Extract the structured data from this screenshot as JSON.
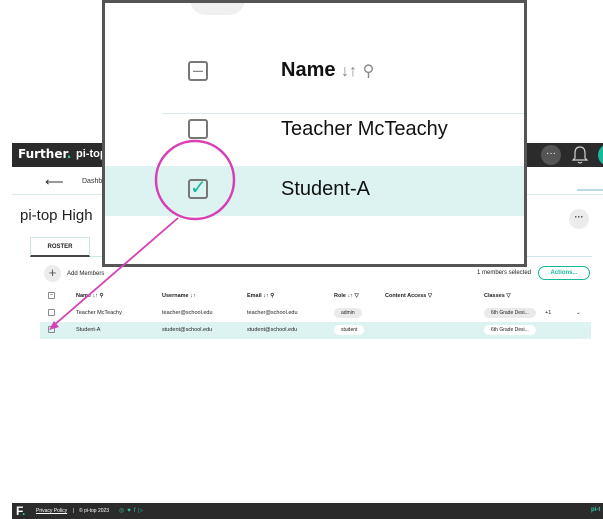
{
  "topbar": {
    "brand": "Further",
    "brand_dot": ".",
    "app_name": "pi-top",
    "avatar_initials": "Th",
    "more_label": "···"
  },
  "subnav": {
    "dashboard_link": "Dashb"
  },
  "page": {
    "title": "pi-top High",
    "more_label": "···"
  },
  "tabs": [
    {
      "label": "ROSTER"
    }
  ],
  "toolbar": {
    "add_label": "Add Members",
    "selected_count": "1 members selected",
    "actions_label": "Actions..."
  },
  "table": {
    "columns": [
      "Name",
      "Username",
      "Email",
      "Role",
      "Content Access",
      "Classes"
    ],
    "rows": [
      {
        "name": "Teacher McTeachy",
        "username": "teacher@school.edu",
        "email": "teacher@school.edu",
        "role": "admin",
        "classes": "6th Grade Desi...",
        "extra": "+1",
        "selected": false
      },
      {
        "name": "Student-A",
        "username": "student@school.edu",
        "email": "student@school.edu",
        "role": "student",
        "classes": "6th Grade Desi...",
        "extra": "",
        "selected": true
      }
    ]
  },
  "zoom": {
    "header": "Name",
    "rows": [
      "Teacher McTeachy",
      "Student-A"
    ]
  },
  "footer": {
    "logo": "F",
    "privacy": "Privacy Policy",
    "separator": "|",
    "copyright": "© pi-top 2023",
    "right_text": "pi-t"
  },
  "colors": {
    "accent": "#16b79a",
    "highlight": "#d63fb6",
    "dark": "#2b2b2b",
    "selected_row": "#ddf3f2"
  }
}
